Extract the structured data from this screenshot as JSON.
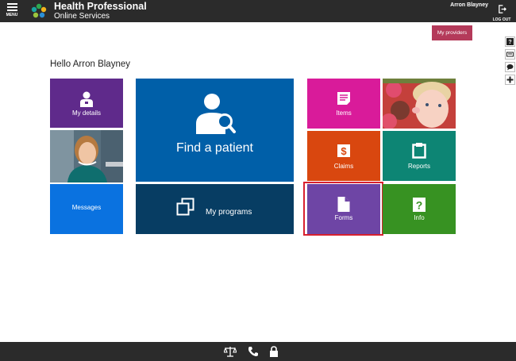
{
  "header": {
    "menu_label": "MENU",
    "brand_line1": "Health Professional",
    "brand_line2": "Online Services",
    "user_name": "Arron Blayney",
    "logout_label": "LOG OUT"
  },
  "providers_button": "My providers",
  "greeting": "Hello Arron Blayney",
  "tiles": {
    "my_details": "My details",
    "messages": "Messages",
    "find_patient": "Find a patient",
    "my_programs": "My programs",
    "items": "Items",
    "claims": "Claims",
    "reports": "Reports",
    "forms": "Forms",
    "info": "Info"
  },
  "side_tools": [
    "help-icon",
    "keyboard-icon",
    "feedback-icon",
    "add-icon"
  ],
  "footer_icons": [
    "scales-icon",
    "phone-icon",
    "lock-icon"
  ],
  "colors": {
    "header_bg": "#2b2b2b",
    "providers": "#b43a5a",
    "my_details": "#5f2a8b",
    "messages": "#0a72e0",
    "find_patient": "#005fa8",
    "my_programs": "#073d63",
    "items": "#d91b9a",
    "claims": "#d9470f",
    "reports": "#0d8574",
    "forms": "#6e45a5",
    "info": "#379222",
    "highlight": "#d8212f"
  }
}
